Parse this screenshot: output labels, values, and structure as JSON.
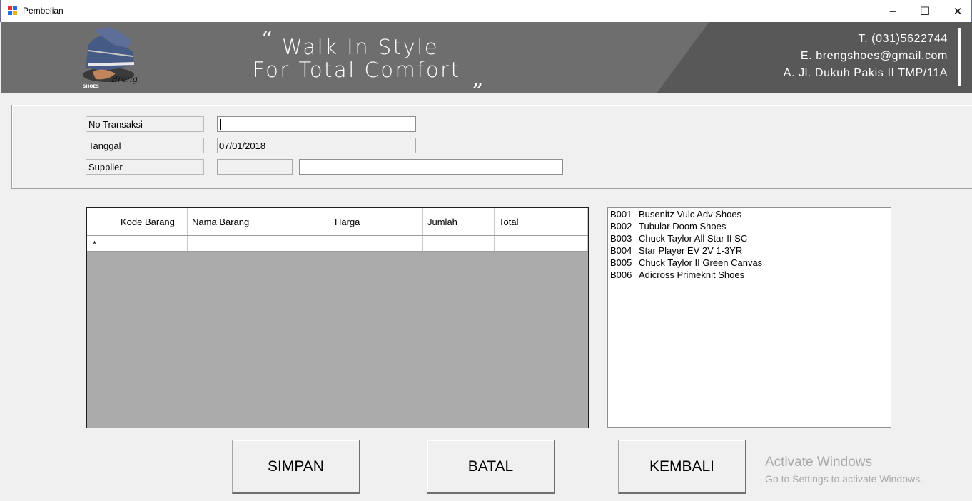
{
  "window": {
    "title": "Pembelian",
    "minimize_glyph": "─",
    "maximize_glyph": "☐",
    "close_glyph": "✕"
  },
  "header": {
    "open_quote": "“",
    "slogan_line1": "Walk In Style",
    "slogan_line2": "For Total Comfort",
    "close_quote": "„",
    "phone": "T.  (031)5622744",
    "email": "E.  brengshoes@gmail.com",
    "address": "A.  Jl. Dukuh Pakis II TMP/11A",
    "logo_brand": "Breng",
    "logo_sub": "SHOES"
  },
  "form": {
    "no_transaksi_label": "No Transaksi",
    "no_transaksi_value": "",
    "tanggal_label": "Tanggal",
    "tanggal_value": "07/01/2018",
    "supplier_label": "Supplier",
    "supplier_code_value": "",
    "supplier_name_value": ""
  },
  "grid": {
    "columns": [
      "Kode Barang",
      "Nama Barang",
      "Harga",
      "Jumlah",
      "Total"
    ],
    "new_row_marker": "*"
  },
  "products": [
    {
      "code": "B001",
      "name": "Busenitz Vulc Adv Shoes"
    },
    {
      "code": "B002",
      "name": "Tubular Doom Shoes"
    },
    {
      "code": "B003",
      "name": "Chuck Taylor All Star II SC"
    },
    {
      "code": "B004",
      "name": "Star Player EV 2V 1-3YR"
    },
    {
      "code": "B005",
      "name": "Chuck Taylor II Green Canvas"
    },
    {
      "code": "B006",
      "name": "Adicross Primeknit Shoes"
    }
  ],
  "buttons": {
    "simpan": "SIMPAN",
    "batal": "BATAL",
    "kembali": "KEMBALI"
  },
  "watermark": {
    "line1": "Activate Windows",
    "line2": "Go to Settings to activate Windows."
  },
  "icons": {
    "app": "form-window-icon",
    "minimize": "minimize-icon",
    "maximize": "maximize-icon",
    "close": "close-icon",
    "logo": "shoe-logo-icon"
  },
  "colors": {
    "banner": "#6e6e6e",
    "banner_dark": "#585858",
    "grid_background": "#ababab",
    "form_background": "#f0f0f0"
  }
}
